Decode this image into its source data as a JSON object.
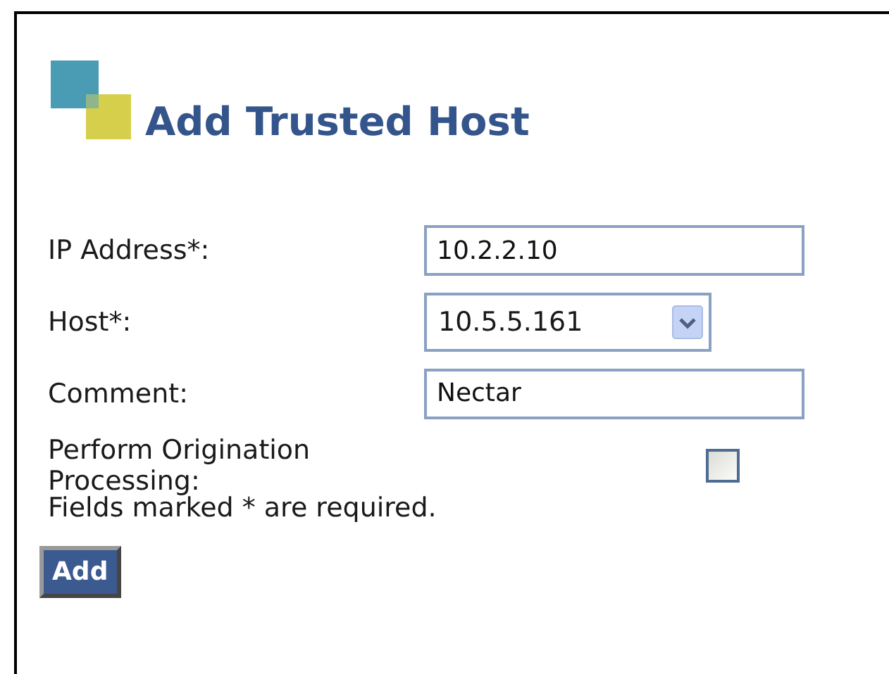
{
  "title": "Add Trusted Host",
  "fields": [
    {
      "kind": "text",
      "label": "IP Address*:",
      "value": "10.2.2.10"
    },
    {
      "kind": "select",
      "label": "Host*:",
      "value": "10.5.5.161"
    },
    {
      "kind": "text",
      "label": "Comment:",
      "value": "Nectar"
    },
    {
      "kind": "checkbox",
      "label": "Perform Origination Processing:",
      "checked": false
    }
  ],
  "note": "Fields marked * are required.",
  "button": "Add"
}
